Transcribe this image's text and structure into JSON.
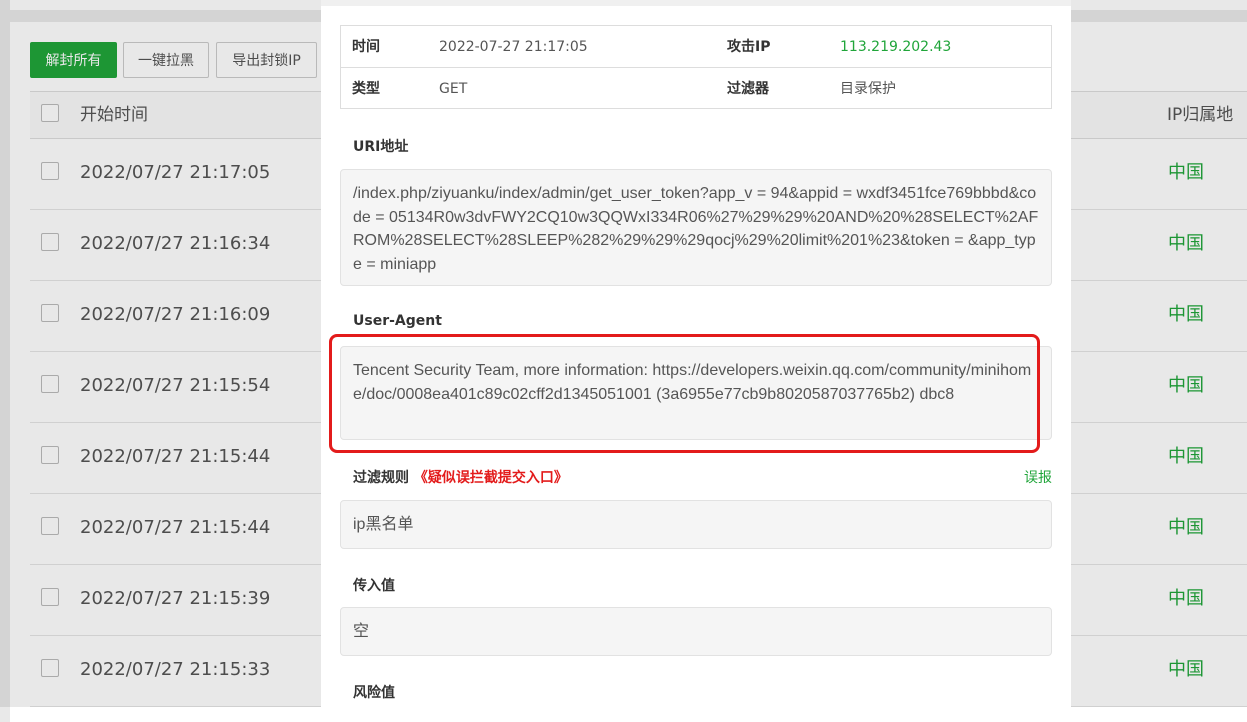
{
  "toolbar": {
    "unblock_all": "解封所有",
    "blacklist_all": "一键拉黑",
    "export_ips": "导出封锁IP"
  },
  "table": {
    "col_start_time": "开始时间",
    "col_ip_location": "IP归属地",
    "rows": [
      {
        "time": "2022/07/27 21:17:05",
        "location": "中国"
      },
      {
        "time": "2022/07/27 21:16:34",
        "location": "中国"
      },
      {
        "time": "2022/07/27 21:16:09",
        "location": "中国"
      },
      {
        "time": "2022/07/27 21:15:54",
        "location": "中国"
      },
      {
        "time": "2022/07/27 21:15:44",
        "location": "中国"
      },
      {
        "time": "2022/07/27 21:15:44",
        "location": "中国"
      },
      {
        "time": "2022/07/27 21:15:39",
        "location": "中国"
      },
      {
        "time": "2022/07/27 21:15:33",
        "location": "中国"
      }
    ]
  },
  "modal": {
    "time_label": "时间",
    "time_value": "2022-07-27 21:17:05",
    "attack_ip_label": "攻击IP",
    "attack_ip_value": "113.219.202.43",
    "type_label": "类型",
    "type_value": "GET",
    "filter_label": "过滤器",
    "filter_value": "目录保护",
    "uri_label": "URI地址",
    "uri_value": "/index.php/ziyuanku/index/admin/get_user_token?app_v = 94&appid = wxdf3451fce769bbbd&code = 05134R0w3dvFWY2CQ10w3QQWxI334R06%27%29%29%20AND%20%28SELECT%2AFROM%28SELECT%28SLEEP%282%29%29%29qocj%29%20limit%201%23&token = &app_type = miniapp",
    "ua_label": "User-Agent",
    "ua_value": "Tencent Security Team, more information: https://developers.weixin.qq.com/community/minihome/doc/0008ea401c89c02cff2d1345051001 (3a6955e77cb9b8020587037765b2) dbc8",
    "rule_label": "过滤规则",
    "rule_appeal": "《疑似误拦截提交入口》",
    "report_link": "误报",
    "rule_value": "ip黑名单",
    "input_label": "传入值",
    "input_value": "空",
    "risk_label": "风险值"
  },
  "colors": {
    "accent_green": "#20a53a",
    "highlight_red": "#e31b1b"
  }
}
